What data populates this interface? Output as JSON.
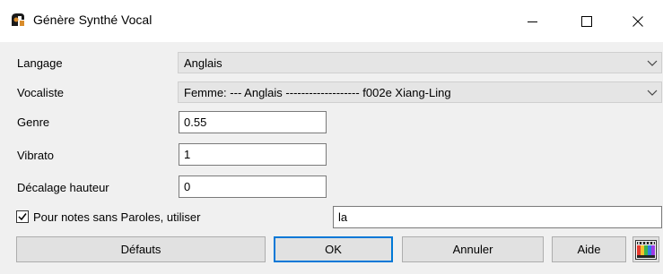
{
  "window": {
    "title": "Génère Synthé Vocal",
    "app_icon": "band-in-a-box-icon",
    "controls": [
      "minimize-icon",
      "maximize-icon",
      "close-icon"
    ]
  },
  "form": {
    "language": {
      "label": "Langage",
      "value": "Anglais"
    },
    "vocalist": {
      "label": "Vocaliste",
      "value": "Femme: --- Anglais ------------------- f002e Xiang-Ling"
    },
    "gender": {
      "label": "Genre",
      "value": "0.55"
    },
    "vibrato": {
      "label": "Vibrato",
      "value": "1"
    },
    "pitch_offset": {
      "label": "Décalage hauteur",
      "value": "0"
    },
    "no_lyrics": {
      "label": "Pour notes sans Paroles, utiliser",
      "checked": true,
      "value": "la"
    }
  },
  "buttons": {
    "defaults": "Défauts",
    "ok": "OK",
    "cancel": "Annuler",
    "help": "Aide"
  },
  "colors": {
    "title_bg": "#ffffff",
    "dialog_bg": "#f0f0f0",
    "focus_border": "#0078d7"
  }
}
